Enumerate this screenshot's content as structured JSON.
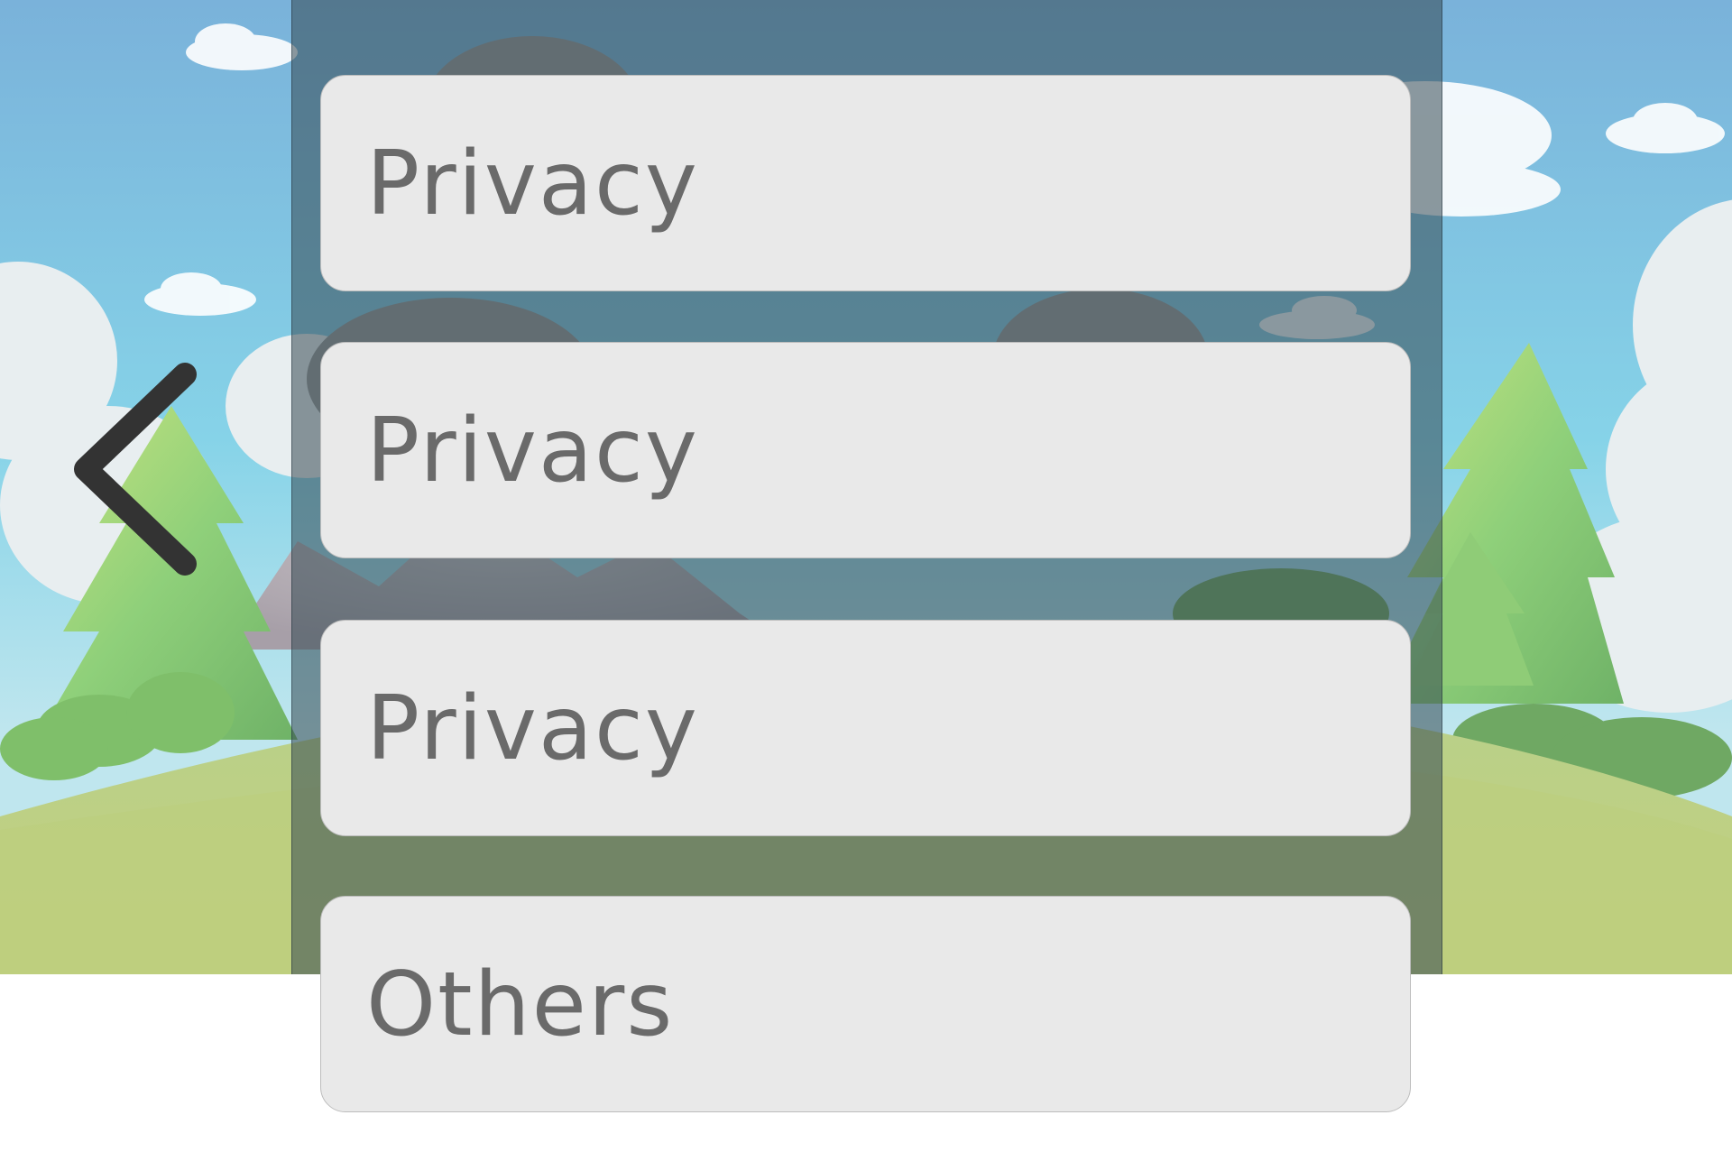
{
  "screen": {
    "background_scene": "cartoon-forest-landscape",
    "overlay_color": "#344852"
  },
  "navigation": {
    "back_icon": "chevron-left-icon"
  },
  "menu": {
    "items": [
      {
        "label": "Privacy"
      },
      {
        "label": "Privacy"
      },
      {
        "label": "Privacy"
      },
      {
        "label": "Others"
      }
    ]
  },
  "colors": {
    "button_background": "#e9e9e9",
    "button_text": "#6a6a6a",
    "chevron": "#333333"
  }
}
